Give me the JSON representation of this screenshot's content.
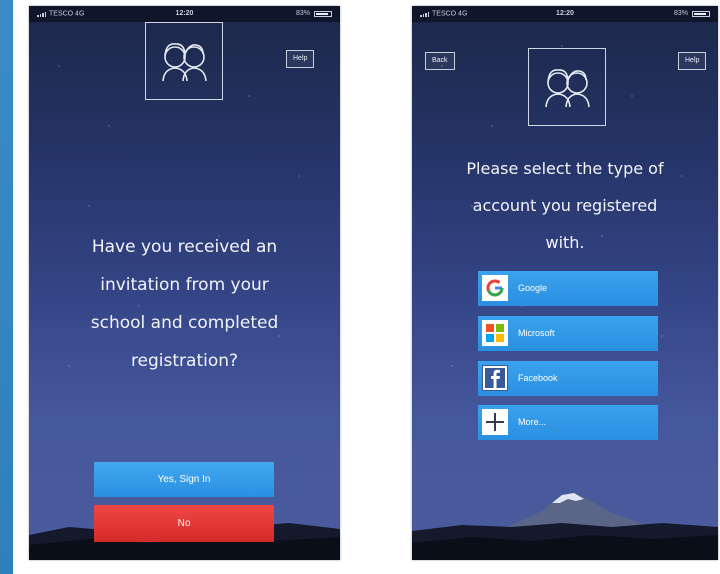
{
  "status_bar": {
    "carrier": "TESCO 4G",
    "time": "12:20",
    "battery": "83%"
  },
  "screen_left": {
    "help_label": "Help",
    "question_lines": [
      "Have you received an",
      "invitation from your",
      "school and completed",
      "registration?"
    ],
    "yes_label": "Yes, Sign In",
    "no_label": "No"
  },
  "screen_right": {
    "back_label": "Back",
    "help_label": "Help",
    "question_lines": [
      "Please select the type of",
      "account you registered",
      "with."
    ],
    "providers": [
      {
        "label": "Google",
        "icon": "google-icon"
      },
      {
        "label": "Microsoft",
        "icon": "microsoft-icon"
      },
      {
        "label": "Facebook",
        "icon": "facebook-icon"
      },
      {
        "label": "More...",
        "icon": "plus-icon"
      }
    ]
  },
  "colors": {
    "button_blue": "#3aa2ee",
    "button_red": "#e23a3a",
    "sky_top": "#1b2748",
    "sky_bottom": "#4a5c9c"
  }
}
